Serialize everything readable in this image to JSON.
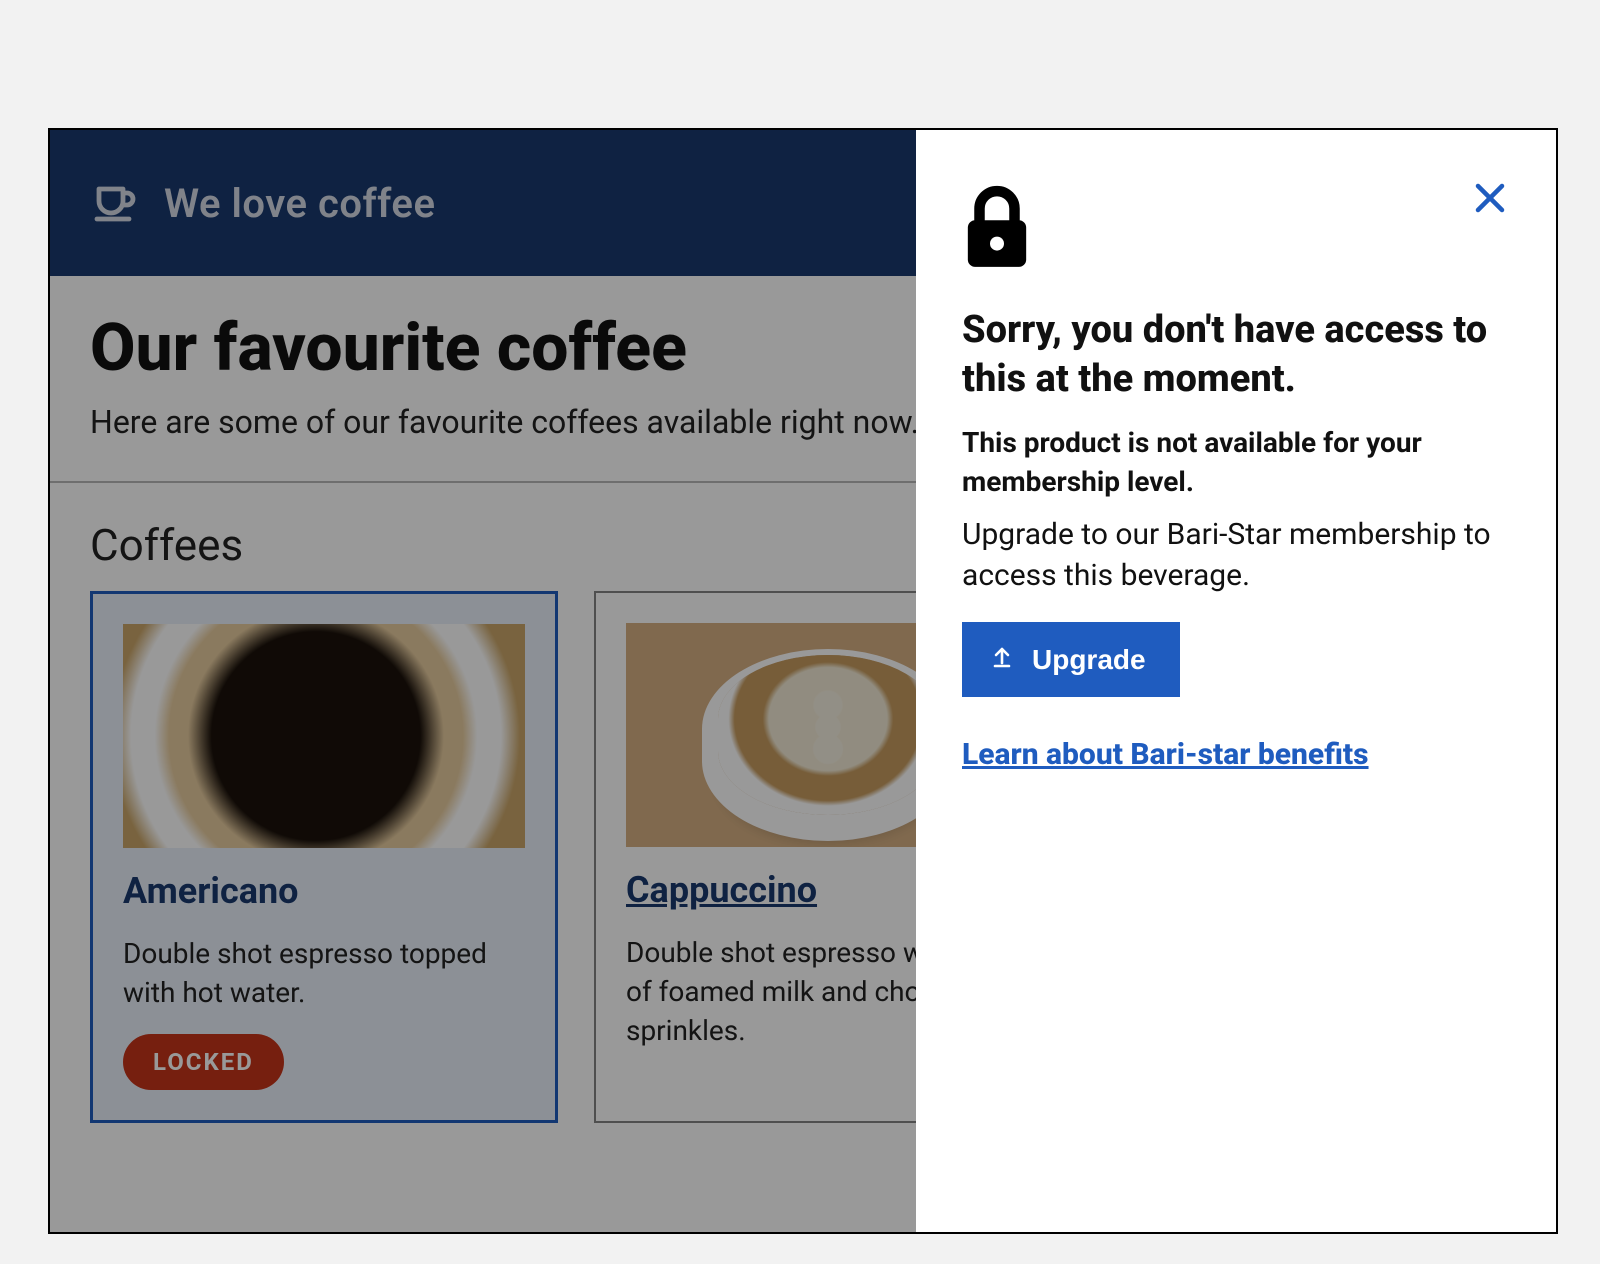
{
  "header": {
    "brand_label": "We love coffee"
  },
  "intro": {
    "title": "Our favourite coffee",
    "subtitle": "Here are some of our favourite coffees available right now."
  },
  "section": {
    "coffees_title": "Coffees"
  },
  "cards": {
    "americano": {
      "title": "Americano",
      "desc": "Double shot espresso topped with hot water.",
      "locked_label": "LOCKED"
    },
    "cappuccino": {
      "title": "Cappuccino",
      "desc": "Double shot espresso with lots of foamed milk and chocolate sprinkles."
    }
  },
  "drawer": {
    "heading": "Sorry, you don't have access to this at the moment.",
    "bold_sub": "This product is not available for your membership level.",
    "body": "Upgrade to our Bari-Star membership to access this beverage.",
    "upgrade_label": "Upgrade",
    "learn_label": "Learn about Bari-star benefits"
  },
  "colors": {
    "brand_navy": "#193a6e",
    "primary_blue": "#1f5cbf",
    "locked_red": "#c53419"
  }
}
